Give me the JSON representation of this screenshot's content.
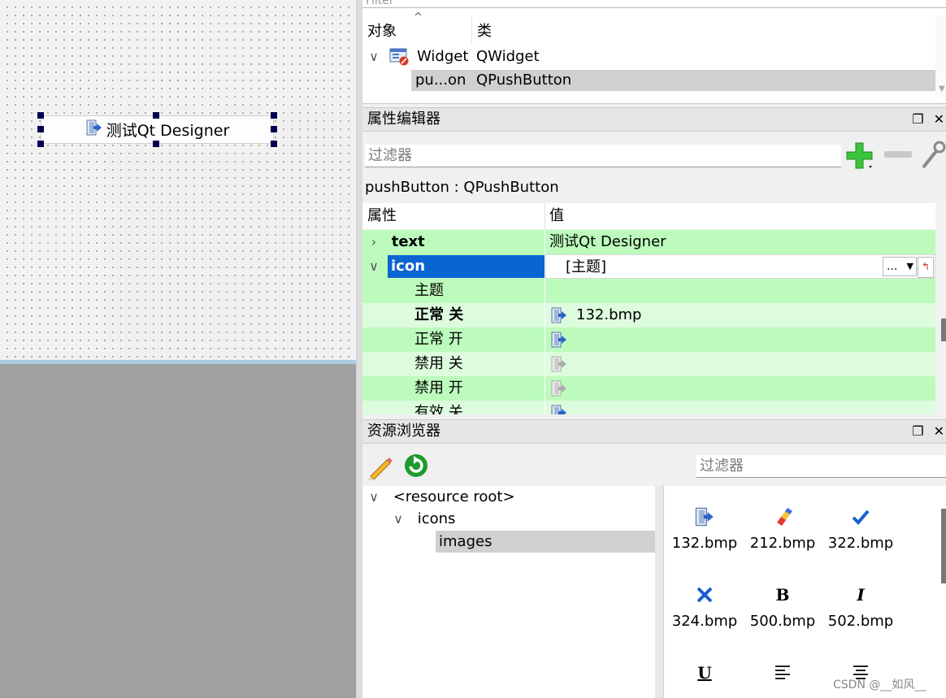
{
  "designer": {
    "button_text": "测试Qt Designer"
  },
  "object_inspector": {
    "filter_label": "Filter",
    "col_object": "对象",
    "col_class": "类",
    "rows": [
      {
        "object": "Widget",
        "class": "QWidget"
      },
      {
        "object": "pu...on",
        "class": "QPushButton"
      }
    ]
  },
  "property_editor": {
    "title": "属性编辑器",
    "filter_placeholder": "过滤器",
    "object_label": "pushButton : QPushButton",
    "col_property": "属性",
    "col_value": "值",
    "rows": [
      {
        "name": "text",
        "value": "测试Qt Designer"
      },
      {
        "name": "icon",
        "value": "[主题]"
      },
      {
        "name": "主题",
        "value": ""
      },
      {
        "name": "正常 关",
        "value": "132.bmp"
      },
      {
        "name": "正常 开",
        "value": ""
      },
      {
        "name": "禁用 关",
        "value": ""
      },
      {
        "name": "禁用 开",
        "value": ""
      },
      {
        "name": "有效 关",
        "value": ""
      }
    ],
    "icon_browse_label": "..."
  },
  "resource_browser": {
    "title": "资源浏览器",
    "filter_placeholder": "过滤器",
    "tree": [
      {
        "label": "<resource root>"
      },
      {
        "label": "icons"
      },
      {
        "label": "images"
      }
    ],
    "files": [
      "132.bmp",
      "212.bmp",
      "322.bmp",
      "324.bmp",
      "500.bmp",
      "502.bmp"
    ]
  },
  "watermark": "CSDN @__如风__",
  "colors": {
    "selection_blue": "#0a64d2",
    "property_green": "#bcfbbc",
    "property_green_light": "#ddfcdd",
    "handle_navy": "#000050"
  }
}
